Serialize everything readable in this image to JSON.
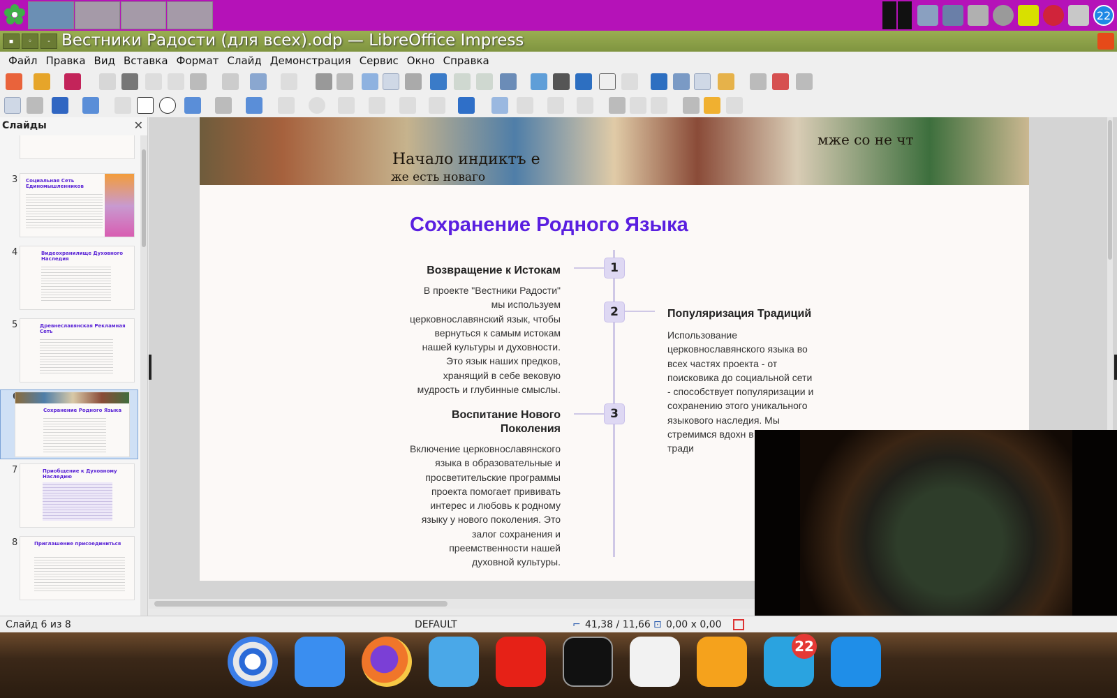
{
  "window": {
    "title": "Вестники Радости (для всех).odp — LibreOffice Impress"
  },
  "menu": [
    "Файл",
    "Правка",
    "Вид",
    "Вставка",
    "Формат",
    "Слайд",
    "Демонстрация",
    "Сервис",
    "Окно",
    "Справка"
  ],
  "slides_pane": {
    "title": "Слайды",
    "thumbs": [
      {
        "num": "3",
        "title": "Социальная Сеть Единомышленников"
      },
      {
        "num": "4",
        "title": "Видеохранилище Духовного Наследия"
      },
      {
        "num": "5",
        "title": "Древнеславянская Рекламная Сеть"
      },
      {
        "num": "6",
        "title": "Сохранение Родного Языка"
      },
      {
        "num": "7",
        "title": "Приобщение к Духовному Наследию"
      },
      {
        "num": "8",
        "title": "Приглашение присоединиться"
      }
    ]
  },
  "slide": {
    "banner_text_left": "Начало индиктъ е",
    "banner_text_left2": "же есть новаго",
    "banner_text_right": "мже  со  не  чт",
    "title": "Сохранение Родного Языка",
    "items": [
      {
        "num": "1",
        "title": "Возвращение к Истокам",
        "body": "В проекте \"Вестники Радости\" мы используем церковнославянский язык, чтобы вернуться к самым истокам нашей культуры и духовности. Это язык наших предков, хранящий в себе вековую мудрость и глубинные смыслы."
      },
      {
        "num": "2",
        "title": "Популяризация Традиций",
        "body": "Использование церковнославянского языка во всех частях проекта - от поисковика до социальной сети - способствует популяризации и сохранению этого уникального языкового наследия. Мы стремимся вдохн в забытые тради"
      },
      {
        "num": "3",
        "title": "Воспитание Нового Поколения",
        "body": "Включение церковнославянского языка в образовательные и просветительские программы проекта помогает прививать интерес и любовь к родному языку у нового поколения. Это залог сохранения и преемственности нашей духовной культуры."
      }
    ]
  },
  "status": {
    "slide": "Слайд 6 из 8",
    "layout": "DEFAULT",
    "position": "41,38 / 11,66",
    "size": "0,00 x 0,00"
  },
  "tray": {
    "badge": "22"
  },
  "dock": {
    "telegram_badge": "22"
  },
  "colors": {
    "title": "#5a1fe0",
    "panel": "#b512b8",
    "titlebar": "#8da048"
  }
}
